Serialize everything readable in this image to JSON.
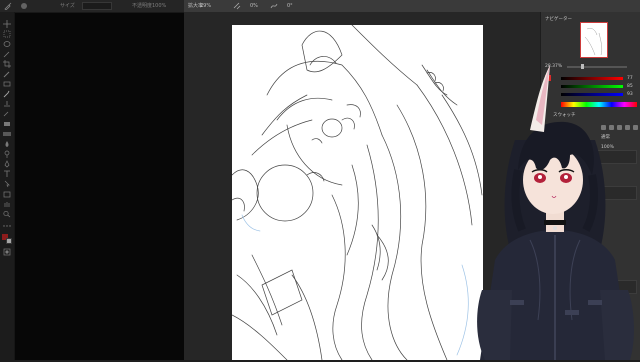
{
  "options_bar": {
    "zoom_label": "拡大率",
    "zoom_value": "29%",
    "opacity_label": "不透明度",
    "opacity_value": "100%",
    "size_label": "サイズ",
    "rotation_value": "0%",
    "angle_value": "0°"
  },
  "panel": {
    "navigator_tab": "ナビゲーター",
    "zoom_value": "28.37%",
    "color_values": [
      "77",
      "85",
      "93"
    ],
    "swatches_tab": "スウォッチ",
    "layers_tab": "レイヤー",
    "blend_mode": "通常",
    "layer_opacity": "100%"
  },
  "colors": {
    "foreground": "#d92b2b",
    "accent": "#cc3b3b",
    "canvas": "#ffffff",
    "workspace": "#262626"
  }
}
